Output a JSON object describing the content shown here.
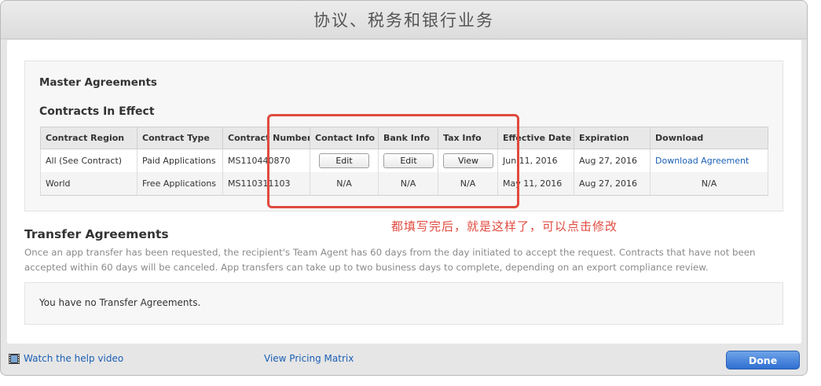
{
  "window": {
    "title": "协议、税务和银行业务"
  },
  "master": {
    "heading": "Master Agreements",
    "contracts_heading": "Contracts In Effect",
    "columns": [
      "Contract Region",
      "Contract Type",
      "Contract Number",
      "Contact Info",
      "Bank Info",
      "Tax Info",
      "Effective Date",
      "Expiration",
      "Download"
    ],
    "rows": [
      {
        "region": "All (See Contract)",
        "type": "Paid Applications",
        "number": "MS110440870",
        "contact": "Edit",
        "bank": "Edit",
        "tax": "View",
        "effective": "Jun 11, 2016",
        "expiration": "Aug 27, 2016",
        "download": "Download Agreement"
      },
      {
        "region": "World",
        "type": "Free Applications",
        "number": "MS110311103",
        "contact": "N/A",
        "bank": "N/A",
        "tax": "N/A",
        "effective": "May 11, 2016",
        "expiration": "Aug 27, 2016",
        "download": "N/A"
      }
    ]
  },
  "annotation": {
    "text": "都填写完后，就是这样了，可以点击修改",
    "color": "#e04a3f"
  },
  "transfer": {
    "heading": "Transfer Agreements",
    "description": "Once an app transfer has been requested, the recipient's Team Agent has 60 days from the day initiated to accept the request. Contracts that have not been accepted within 60 days will be canceled. App transfers can take up to two business days to complete, depending on an export compliance review.",
    "empty_text": "You have no Transfer Agreements."
  },
  "footer": {
    "help_link": "Watch the help video",
    "help_icon": "film-icon",
    "pricing_link": "View Pricing Matrix",
    "done_label": "Done"
  },
  "colors": {
    "link": "#1a5fb4",
    "done_button": "#2f6fd1"
  }
}
